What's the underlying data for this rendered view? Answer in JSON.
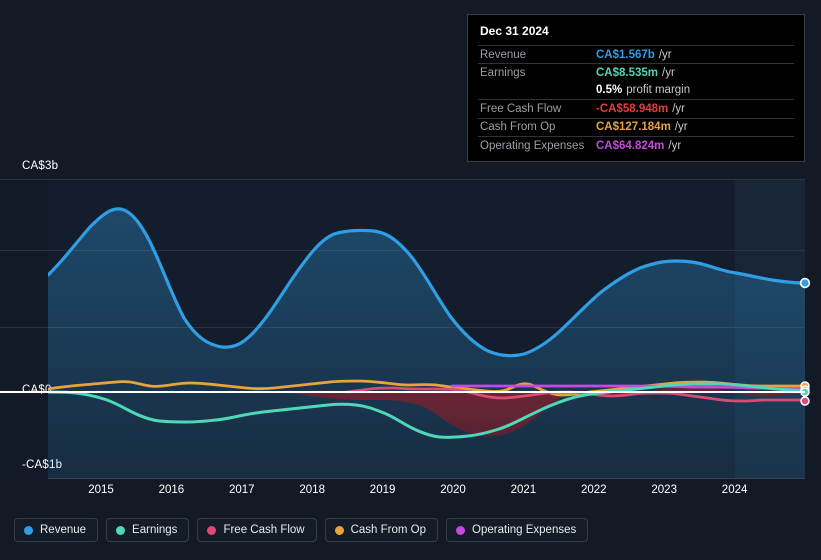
{
  "tooltip": {
    "date": "Dec 31 2024",
    "rows": [
      {
        "label": "Revenue",
        "value": "CA$1.567b",
        "unit": "/yr",
        "color": "#2f9ee4"
      },
      {
        "label": "Earnings",
        "value": "CA$8.535m",
        "unit": "/yr",
        "color": "#4fd8b8"
      },
      {
        "label": "",
        "value": "0.5%",
        "unit": "profit margin",
        "color": "#ffffff"
      },
      {
        "label": "Free Cash Flow",
        "value": "-CA$58.948m",
        "unit": "/yr",
        "color": "#e33d3d"
      },
      {
        "label": "Cash From Op",
        "value": "CA$127.184m",
        "unit": "/yr",
        "color": "#e8a33d"
      },
      {
        "label": "Operating Expenses",
        "value": "CA$64.824m",
        "unit": "/yr",
        "color": "#c44ae0"
      }
    ]
  },
  "legend": {
    "items": [
      {
        "label": "Revenue",
        "color": "#2f9ee4"
      },
      {
        "label": "Earnings",
        "color": "#4fd8b8"
      },
      {
        "label": "Free Cash Flow",
        "color": "#de4a77"
      },
      {
        "label": "Cash From Op",
        "color": "#e8a33d"
      },
      {
        "label": "Operating Expenses",
        "color": "#c44ae0"
      }
    ]
  },
  "chart_data": {
    "type": "area",
    "title": "",
    "xlabel": "",
    "ylabel": "",
    "currency": "CA$",
    "ylim": [
      -1,
      3
    ],
    "ytick_labels": [
      "CA$3b",
      "CA$0",
      "-CA$1b"
    ],
    "ytick_values": [
      3,
      0,
      -1
    ],
    "grid": true,
    "legend_position": "bottom",
    "x_tick_labels": [
      "2015",
      "2016",
      "2017",
      "2018",
      "2019",
      "2020",
      "2021",
      "2022",
      "2023",
      "2024"
    ],
    "x": [
      2014.3,
      2014.6,
      2015.0,
      2015.3,
      2015.6,
      2016.0,
      2016.3,
      2016.6,
      2017.0,
      2017.3,
      2017.6,
      2018.0,
      2018.3,
      2018.6,
      2019.0,
      2019.3,
      2019.6,
      2020.0,
      2020.3,
      2020.6,
      2021.0,
      2021.3,
      2021.6,
      2022.0,
      2022.3,
      2022.6,
      2023.0,
      2023.3,
      2023.6,
      2024.0,
      2024.3,
      2024.6,
      2025.0
    ],
    "series": [
      {
        "name": "Revenue",
        "color": "#2f9ee4",
        "unit": "b",
        "values": [
          1.64,
          2.05,
          2.55,
          2.56,
          2.33,
          1.71,
          1.36,
          1.23,
          1.31,
          1.6,
          1.93,
          2.24,
          2.46,
          2.5,
          2.44,
          2.27,
          1.95,
          1.58,
          1.36,
          1.27,
          1.32,
          1.43,
          1.52,
          1.62,
          1.75,
          1.92,
          2.02,
          2.03,
          1.97,
          1.82,
          1.72,
          1.64,
          1.567
        ]
      },
      {
        "name": "Earnings",
        "color": "#4fd8b8",
        "unit": "m",
        "values": [
          0.02,
          0.01,
          -0.01,
          -0.06,
          -0.14,
          -0.25,
          -0.29,
          -0.28,
          -0.24,
          -0.21,
          -0.2,
          -0.21,
          -0.22,
          -0.23,
          -0.28,
          -0.4,
          -0.56,
          -0.64,
          -0.65,
          -0.62,
          -0.44,
          -0.18,
          -0.06,
          -0.03,
          0.0,
          0.03,
          0.06,
          0.1,
          0.13,
          0.12,
          0.09,
          0.04,
          0.0085
        ]
      },
      {
        "name": "Free Cash Flow",
        "color": "#de4a77",
        "unit": "m",
        "values": [
          null,
          null,
          null,
          null,
          null,
          null,
          null,
          null,
          null,
          null,
          null,
          null,
          null,
          0.03,
          0.1,
          0.11,
          0.09,
          0.11,
          0.06,
          -0.06,
          -0.1,
          -0.09,
          -0.06,
          -0.04,
          -0.03,
          -0.02,
          -0.01,
          -0.01,
          -0.02,
          -0.04,
          -0.05,
          -0.06,
          -0.058948
        ]
      },
      {
        "name": "Cash From Op",
        "color": "#e8a33d",
        "unit": "m",
        "values": [
          0.06,
          0.1,
          0.14,
          0.16,
          0.14,
          0.17,
          0.19,
          0.17,
          0.13,
          0.11,
          0.09,
          0.11,
          0.16,
          0.21,
          0.24,
          0.22,
          0.23,
          0.19,
          0.1,
          0.08,
          0.15,
          0.08,
          0.06,
          0.07,
          0.09,
          0.12,
          0.16,
          0.19,
          0.18,
          0.17,
          0.16,
          0.14,
          0.127184
        ]
      },
      {
        "name": "Operating Expenses",
        "color": "#c44ae0",
        "unit": "m",
        "values": [
          null,
          null,
          null,
          null,
          null,
          null,
          null,
          null,
          null,
          null,
          null,
          null,
          null,
          null,
          null,
          null,
          null,
          null,
          0.08,
          0.08,
          0.08,
          0.08,
          0.08,
          0.08,
          0.08,
          0.08,
          0.08,
          0.08,
          0.08,
          0.08,
          0.07,
          0.07,
          0.064824
        ]
      }
    ]
  },
  "axis": {
    "y_top": "CA$3b",
    "y_zero": "CA$0",
    "y_bottom": "-CA$1b",
    "years": [
      "2015",
      "2016",
      "2017",
      "2018",
      "2019",
      "2020",
      "2021",
      "2022",
      "2023",
      "2024"
    ]
  }
}
